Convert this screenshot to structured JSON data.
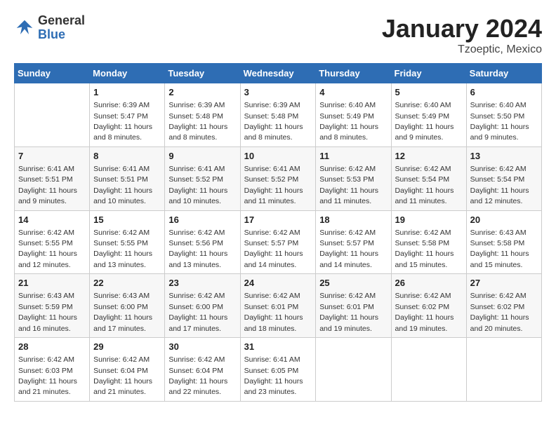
{
  "header": {
    "logo_line1": "General",
    "logo_line2": "Blue",
    "month": "January 2024",
    "location": "Tzoeptic, Mexico"
  },
  "days_of_week": [
    "Sunday",
    "Monday",
    "Tuesday",
    "Wednesday",
    "Thursday",
    "Friday",
    "Saturday"
  ],
  "weeks": [
    [
      {
        "day": "",
        "info": ""
      },
      {
        "day": "1",
        "info": "Sunrise: 6:39 AM\nSunset: 5:47 PM\nDaylight: 11 hours\nand 8 minutes."
      },
      {
        "day": "2",
        "info": "Sunrise: 6:39 AM\nSunset: 5:48 PM\nDaylight: 11 hours\nand 8 minutes."
      },
      {
        "day": "3",
        "info": "Sunrise: 6:39 AM\nSunset: 5:48 PM\nDaylight: 11 hours\nand 8 minutes."
      },
      {
        "day": "4",
        "info": "Sunrise: 6:40 AM\nSunset: 5:49 PM\nDaylight: 11 hours\nand 8 minutes."
      },
      {
        "day": "5",
        "info": "Sunrise: 6:40 AM\nSunset: 5:49 PM\nDaylight: 11 hours\nand 9 minutes."
      },
      {
        "day": "6",
        "info": "Sunrise: 6:40 AM\nSunset: 5:50 PM\nDaylight: 11 hours\nand 9 minutes."
      }
    ],
    [
      {
        "day": "7",
        "info": "Sunrise: 6:41 AM\nSunset: 5:51 PM\nDaylight: 11 hours\nand 9 minutes."
      },
      {
        "day": "8",
        "info": "Sunrise: 6:41 AM\nSunset: 5:51 PM\nDaylight: 11 hours\nand 10 minutes."
      },
      {
        "day": "9",
        "info": "Sunrise: 6:41 AM\nSunset: 5:52 PM\nDaylight: 11 hours\nand 10 minutes."
      },
      {
        "day": "10",
        "info": "Sunrise: 6:41 AM\nSunset: 5:52 PM\nDaylight: 11 hours\nand 11 minutes."
      },
      {
        "day": "11",
        "info": "Sunrise: 6:42 AM\nSunset: 5:53 PM\nDaylight: 11 hours\nand 11 minutes."
      },
      {
        "day": "12",
        "info": "Sunrise: 6:42 AM\nSunset: 5:54 PM\nDaylight: 11 hours\nand 11 minutes."
      },
      {
        "day": "13",
        "info": "Sunrise: 6:42 AM\nSunset: 5:54 PM\nDaylight: 11 hours\nand 12 minutes."
      }
    ],
    [
      {
        "day": "14",
        "info": "Sunrise: 6:42 AM\nSunset: 5:55 PM\nDaylight: 11 hours\nand 12 minutes."
      },
      {
        "day": "15",
        "info": "Sunrise: 6:42 AM\nSunset: 5:55 PM\nDaylight: 11 hours\nand 13 minutes."
      },
      {
        "day": "16",
        "info": "Sunrise: 6:42 AM\nSunset: 5:56 PM\nDaylight: 11 hours\nand 13 minutes."
      },
      {
        "day": "17",
        "info": "Sunrise: 6:42 AM\nSunset: 5:57 PM\nDaylight: 11 hours\nand 14 minutes."
      },
      {
        "day": "18",
        "info": "Sunrise: 6:42 AM\nSunset: 5:57 PM\nDaylight: 11 hours\nand 14 minutes."
      },
      {
        "day": "19",
        "info": "Sunrise: 6:42 AM\nSunset: 5:58 PM\nDaylight: 11 hours\nand 15 minutes."
      },
      {
        "day": "20",
        "info": "Sunrise: 6:43 AM\nSunset: 5:58 PM\nDaylight: 11 hours\nand 15 minutes."
      }
    ],
    [
      {
        "day": "21",
        "info": "Sunrise: 6:43 AM\nSunset: 5:59 PM\nDaylight: 11 hours\nand 16 minutes."
      },
      {
        "day": "22",
        "info": "Sunrise: 6:43 AM\nSunset: 6:00 PM\nDaylight: 11 hours\nand 17 minutes."
      },
      {
        "day": "23",
        "info": "Sunrise: 6:42 AM\nSunset: 6:00 PM\nDaylight: 11 hours\nand 17 minutes."
      },
      {
        "day": "24",
        "info": "Sunrise: 6:42 AM\nSunset: 6:01 PM\nDaylight: 11 hours\nand 18 minutes."
      },
      {
        "day": "25",
        "info": "Sunrise: 6:42 AM\nSunset: 6:01 PM\nDaylight: 11 hours\nand 19 minutes."
      },
      {
        "day": "26",
        "info": "Sunrise: 6:42 AM\nSunset: 6:02 PM\nDaylight: 11 hours\nand 19 minutes."
      },
      {
        "day": "27",
        "info": "Sunrise: 6:42 AM\nSunset: 6:02 PM\nDaylight: 11 hours\nand 20 minutes."
      }
    ],
    [
      {
        "day": "28",
        "info": "Sunrise: 6:42 AM\nSunset: 6:03 PM\nDaylight: 11 hours\nand 21 minutes."
      },
      {
        "day": "29",
        "info": "Sunrise: 6:42 AM\nSunset: 6:04 PM\nDaylight: 11 hours\nand 21 minutes."
      },
      {
        "day": "30",
        "info": "Sunrise: 6:42 AM\nSunset: 6:04 PM\nDaylight: 11 hours\nand 22 minutes."
      },
      {
        "day": "31",
        "info": "Sunrise: 6:41 AM\nSunset: 6:05 PM\nDaylight: 11 hours\nand 23 minutes."
      },
      {
        "day": "",
        "info": ""
      },
      {
        "day": "",
        "info": ""
      },
      {
        "day": "",
        "info": ""
      }
    ]
  ]
}
